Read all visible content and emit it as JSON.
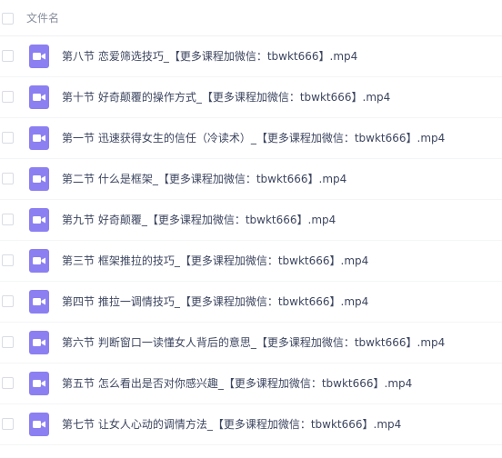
{
  "header": {
    "column_label": "文件名"
  },
  "icons": {
    "file_type_icon": "video-file-icon",
    "accent_color": "#8b7ff2"
  },
  "files": [
    {
      "name": "第八节 恋爱筛选技巧_【更多课程加微信：tbwkt666】.mp4"
    },
    {
      "name": "第十节 好奇颠覆的操作方式_【更多课程加微信：tbwkt666】.mp4"
    },
    {
      "name": "第一节 迅速获得女生的信任（冷读术）_【更多课程加微信：tbwkt666】.mp4"
    },
    {
      "name": "第二节 什么是框架_【更多课程加微信：tbwkt666】.mp4"
    },
    {
      "name": "第九节 好奇颠覆_【更多课程加微信：tbwkt666】.mp4"
    },
    {
      "name": "第三节 框架推拉的技巧_【更多课程加微信：tbwkt666】.mp4"
    },
    {
      "name": "第四节 推拉一调情技巧_【更多课程加微信：tbwkt666】.mp4"
    },
    {
      "name": "第六节 判断窗口一读懂女人背后的意思_【更多课程加微信：tbwkt666】.mp4"
    },
    {
      "name": "第五节 怎么看出是否对你感兴趣_【更多课程加微信：tbwkt666】.mp4"
    },
    {
      "name": "第七节 让女人心动的调情方法_【更多课程加微信：tbwkt666】.mp4"
    }
  ]
}
